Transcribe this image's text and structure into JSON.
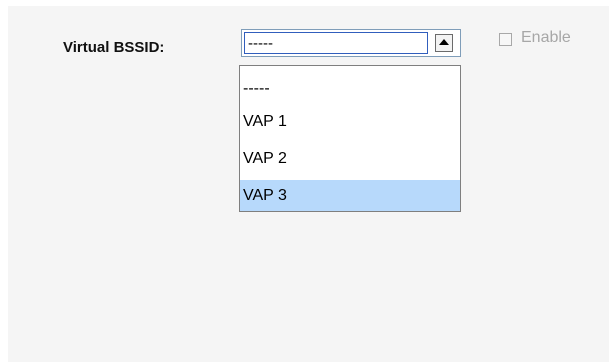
{
  "form": {
    "virtual_bssid_label": "Virtual BSSID:"
  },
  "select": {
    "current_value": "-----",
    "options": [
      {
        "label": "-----"
      },
      {
        "label": "VAP 1"
      },
      {
        "label": "VAP 2"
      },
      {
        "label": "VAP 3"
      }
    ],
    "highlighted_option": "VAP 3"
  },
  "checkbox": {
    "label": "Enable",
    "checked": false,
    "disabled": true
  },
  "icons": {
    "dropdown_arrow": "chevron-up-icon"
  },
  "colors": {
    "panel_background": "#f5f5f5",
    "selected_option_background": "#b7d9fb",
    "disabled_text": "#a7a7a7"
  }
}
